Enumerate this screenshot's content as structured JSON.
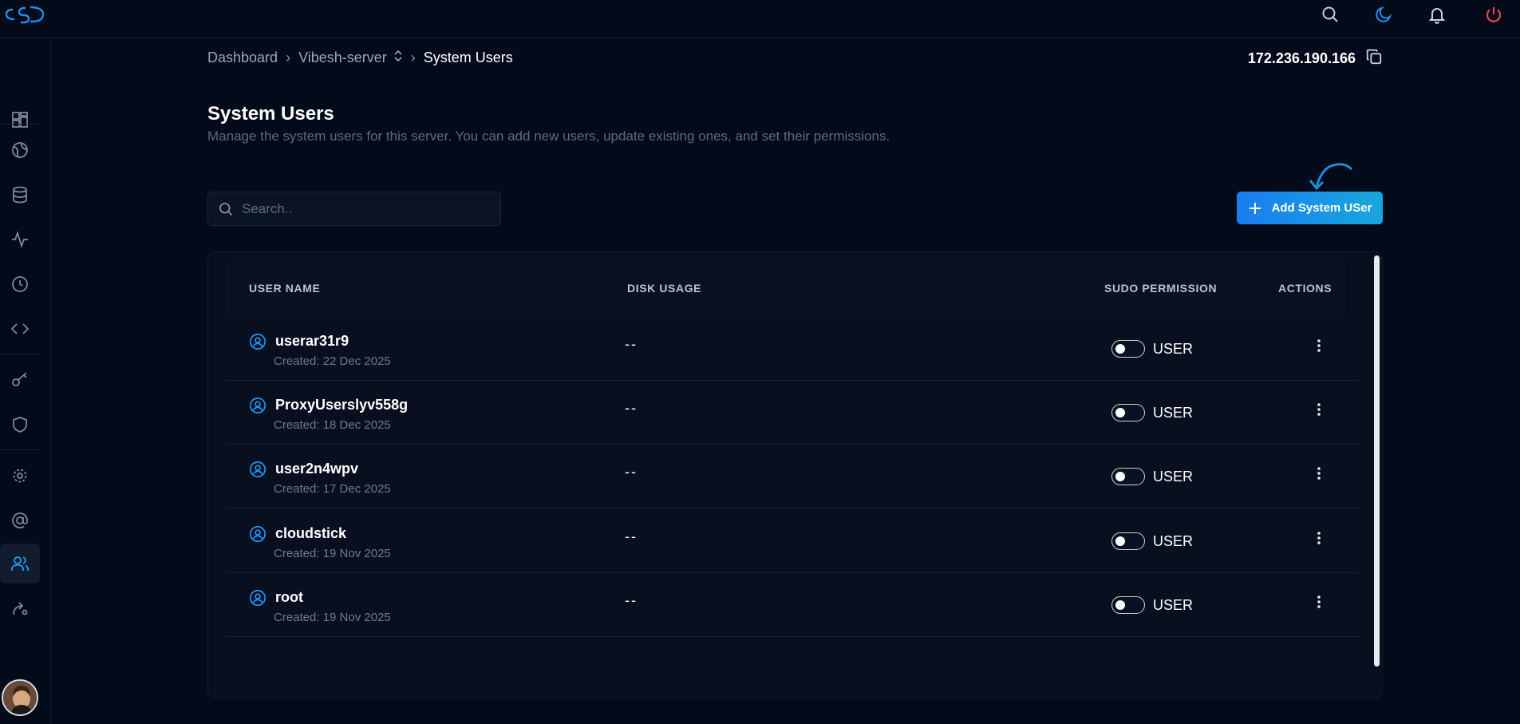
{
  "topbar": {
    "logo_text": "cSD",
    "icons": [
      "search-icon",
      "moon-icon",
      "bell-icon",
      "power-icon"
    ],
    "power_color": "#e5484d",
    "accent_color": "#1d8ff0"
  },
  "sidebar": {
    "items": [
      "dashboard-icon",
      "globe-icon",
      "database-icon",
      "activity-icon",
      "clock-icon",
      "code-icon",
      "key-icon",
      "shield-icon",
      "settings-icon",
      "at-icon",
      "users-icon",
      "deploy-icon"
    ],
    "active_item": "users-icon"
  },
  "breadcrumb": {
    "items": [
      "Dashboard",
      "Vibesh-server",
      "System Users"
    ]
  },
  "server_ip": "172.236.190.166",
  "page": {
    "title": "System Users",
    "description": "Manage the system users for this server. You can add new users, update existing ones, and set their permissions."
  },
  "search": {
    "placeholder": "Search.."
  },
  "add_button_label": "Add System USer",
  "table": {
    "headers": [
      "USER NAME",
      "DISK USAGE",
      "SUDO PERMISSION",
      "ACTIONS"
    ],
    "rows": [
      {
        "name": "userar31r9",
        "created": "Created: 22 Dec 2025",
        "disk": "--",
        "role": "USER",
        "sudo": false
      },
      {
        "name": "ProxyUserslyv558g",
        "created": "Created: 18 Dec 2025",
        "disk": "--",
        "role": "USER",
        "sudo": false
      },
      {
        "name": "user2n4wpv",
        "created": "Created: 17 Dec 2025",
        "disk": "--",
        "role": "USER",
        "sudo": false
      },
      {
        "name": "cloudstick",
        "created": "Created: 19 Nov 2025",
        "disk": "--",
        "role": "USER",
        "sudo": false
      },
      {
        "name": "root",
        "created": "Created: 19 Nov 2025",
        "disk": "--",
        "role": "USER",
        "sudo": false
      }
    ]
  }
}
